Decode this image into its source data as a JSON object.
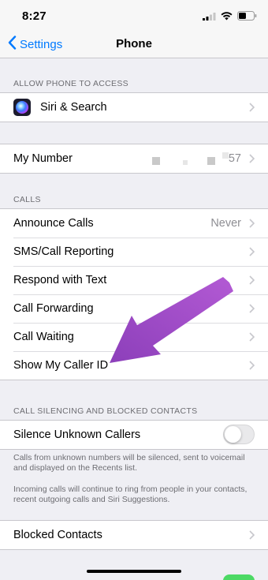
{
  "status_bar": {
    "time": "8:27"
  },
  "nav": {
    "back_label": "Settings",
    "title": "Phone"
  },
  "sections": {
    "allow_access": {
      "header": "ALLOW PHONE TO ACCESS",
      "items": [
        {
          "label": "Siri & Search",
          "icon": "siri-icon"
        }
      ]
    },
    "my_number": {
      "label": "My Number",
      "value_suffix": "57"
    },
    "calls": {
      "header": "CALLS",
      "items": [
        {
          "label": "Announce Calls",
          "value": "Never"
        },
        {
          "label": "SMS/Call Reporting"
        },
        {
          "label": "Respond with Text"
        },
        {
          "label": "Call Forwarding"
        },
        {
          "label": "Call Waiting"
        },
        {
          "label": "Show My Caller ID"
        }
      ]
    },
    "silencing": {
      "header": "CALL SILENCING AND BLOCKED CONTACTS",
      "toggle_label": "Silence Unknown Callers",
      "toggle_on": false,
      "footer_1": "Calls from unknown numbers will be silenced, sent to voicemail and displayed on the Recents list.",
      "footer_2": "Incoming calls will continue to ring from people in your contacts, recent outgoing calls and Siri Suggestions."
    },
    "blocked": {
      "label": "Blocked Contacts"
    }
  },
  "colors": {
    "accent": "#007aff",
    "annotation_arrow": "#9b4fc4",
    "toggle_on": "#4cd964"
  }
}
